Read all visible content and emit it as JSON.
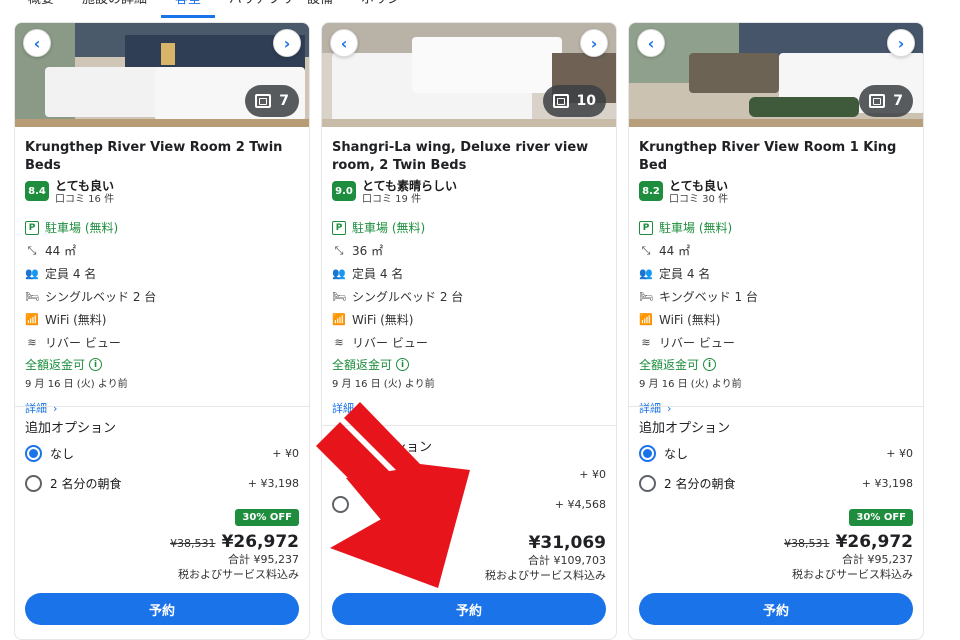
{
  "tabs": [
    "概要",
    "施設の詳細",
    "客室",
    "バリアフリー設備",
    "ポリシー"
  ],
  "tabs_active_index": 2,
  "colors": {
    "accent": "#1a73e8",
    "green": "#1e8e3e",
    "overlay_arrow": "#e8141c"
  },
  "common": {
    "refund_label": "全額返金可",
    "refund_date": "9 月 16 日 (火) より前",
    "detail_link": "詳細",
    "options_title": "追加オプション",
    "book_label": "予約",
    "prev_icon": "‹",
    "next_icon": "›"
  },
  "cards": [
    {
      "title": "Krungthep River View Room 2 Twin Beds",
      "photo_count": "7",
      "score": "8.4",
      "rating_label": "とても良い",
      "review_count": "口コミ 16 件",
      "amenities": {
        "parking": "駐車場 (無料)",
        "size": "44 ㎡",
        "capacity": "定員 4 名",
        "bed": "シングルベッド 2 台",
        "wifi": "WiFi (無料)",
        "view": "リバー ビュー"
      },
      "options": [
        {
          "label": "なし",
          "price": "+ ¥0",
          "selected": true
        },
        {
          "label": "2 名分の朝食",
          "price": "+ ¥3,198",
          "selected": false
        }
      ],
      "discount": "30% OFF",
      "old_price": "¥38,531",
      "price": "¥26,972",
      "total": "合計 ¥95,237",
      "tax_note": "税およびサービス料込み"
    },
    {
      "title": "Shangri-La wing, Deluxe river view room, 2 Twin Beds",
      "photo_count": "10",
      "score": "9.0",
      "rating_label": "とても素晴らしい",
      "review_count": "口コミ 19 件",
      "amenities": {
        "parking": "駐車場 (無料)",
        "size": "36 ㎡",
        "capacity": "定員 4 名",
        "bed": "シングルベッド 2 台",
        "wifi": "WiFi (無料)",
        "view": "リバー ビュー"
      },
      "options_title_visible": "プション",
      "options": [
        {
          "label": "",
          "price": "+ ¥0",
          "selected": false
        },
        {
          "label": "",
          "price": "+ ¥4,568",
          "selected": false
        }
      ],
      "discount": "",
      "old_price": "",
      "price": "¥31,069",
      "total": "合計 ¥109,703",
      "tax_note": "税およびサービス料込み"
    },
    {
      "title": "Krungthep River View Room 1 King Bed",
      "photo_count": "7",
      "score": "8.2",
      "rating_label": "とても良い",
      "review_count": "口コミ 30 件",
      "amenities": {
        "parking": "駐車場 (無料)",
        "size": "44 ㎡",
        "capacity": "定員 4 名",
        "bed": "キングベッド 1 台",
        "wifi": "WiFi (無料)",
        "view": "リバー ビュー"
      },
      "options": [
        {
          "label": "なし",
          "price": "+ ¥0",
          "selected": true
        },
        {
          "label": "2 名分の朝食",
          "price": "+ ¥3,198",
          "selected": false
        }
      ],
      "discount": "30% OFF",
      "old_price": "¥38,531",
      "price": "¥26,972",
      "total": "合計 ¥95,237",
      "tax_note": "税およびサービス料込み"
    }
  ]
}
